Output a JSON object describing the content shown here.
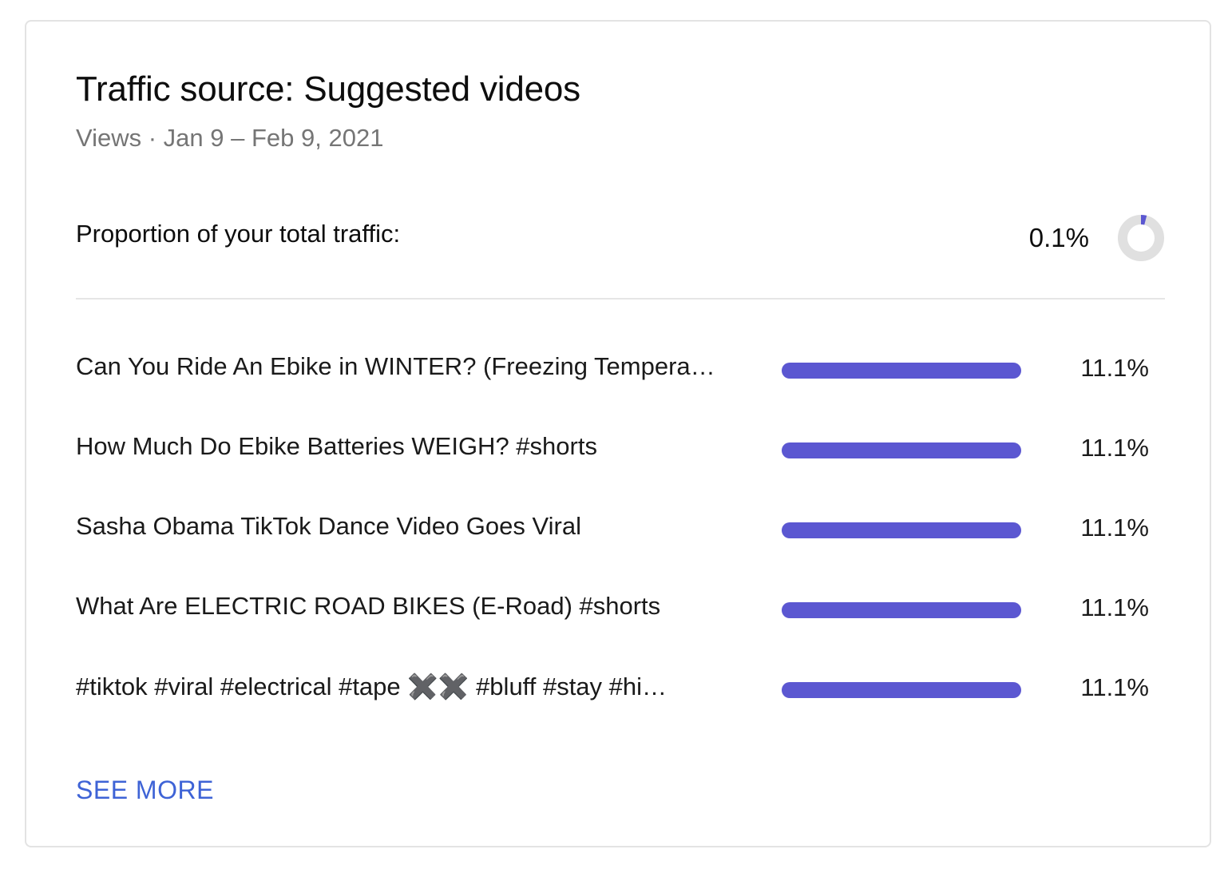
{
  "card": {
    "title": "Traffic source: Suggested videos",
    "subtitle": "Views · Jan 9 – Feb 9, 2021",
    "proportion_label": "Proportion of your total traffic:",
    "proportion_value": "0.1%",
    "proportion_fraction": 0.001,
    "see_more": "SEE MORE"
  },
  "colors": {
    "bar": "#5b57d1",
    "donut_track": "#e0e0e0",
    "donut_fill": "#5b57d1",
    "link": "#3e63d6"
  },
  "chart_data": {
    "type": "bar",
    "categories": [
      "Can You Ride An Ebike in WINTER? (Freezing Tempera…",
      "How Much Do Ebike Batteries WEIGH? #shorts",
      "Sasha Obama TikTok Dance Video Goes Viral",
      "What Are ELECTRIC ROAD BIKES (E-Road) #shorts",
      "#tiktok #viral #electrical #tape ✖️✖️ #bluff #stay #hi…"
    ],
    "values": [
      11.1,
      11.1,
      11.1,
      11.1,
      11.1
    ],
    "value_labels": [
      "11.1%",
      "11.1%",
      "11.1%",
      "11.1%",
      "11.1%"
    ],
    "bar_fill_fraction": [
      1,
      1,
      1,
      1,
      1
    ]
  }
}
